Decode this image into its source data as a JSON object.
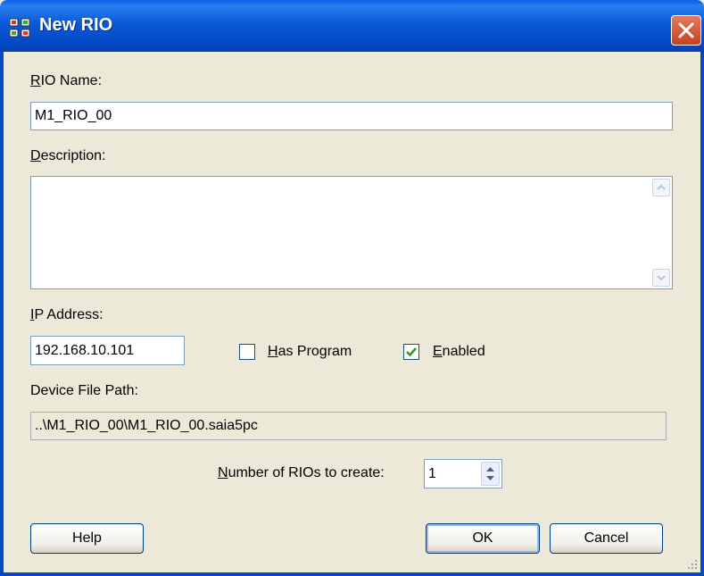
{
  "window": {
    "title": "New RIO",
    "close_icon": "close-icon",
    "app_icon": "rio-network-icon"
  },
  "form": {
    "rio_name": {
      "label_prefix": "",
      "label_accel": "R",
      "label_rest": "IO Name:",
      "value": "M1_RIO_00"
    },
    "description": {
      "label_accel": "D",
      "label_rest": "escription:",
      "value": ""
    },
    "ip_address": {
      "label_accel": "I",
      "label_rest": "P Address:",
      "value": "192.168.10.101"
    },
    "has_program": {
      "label_accel": "H",
      "label_rest": "as Program",
      "checked": false
    },
    "enabled": {
      "label_accel": "E",
      "label_rest": "nabled",
      "checked": true
    },
    "device_file_path": {
      "label": "Device File Path:",
      "value": "..\\M1_RIO_00\\M1_RIO_00.saia5pc"
    },
    "number_of_rios": {
      "label_accel": "N",
      "label_rest": "umber of RIOs to create:",
      "value": "1"
    }
  },
  "buttons": {
    "help": "Help",
    "ok": "OK",
    "cancel": "Cancel"
  },
  "colors": {
    "title_bar": "#0348c4",
    "dialog_bg": "#ece9d8",
    "check_mark": "#21a121",
    "close_button": "#c8401f"
  }
}
